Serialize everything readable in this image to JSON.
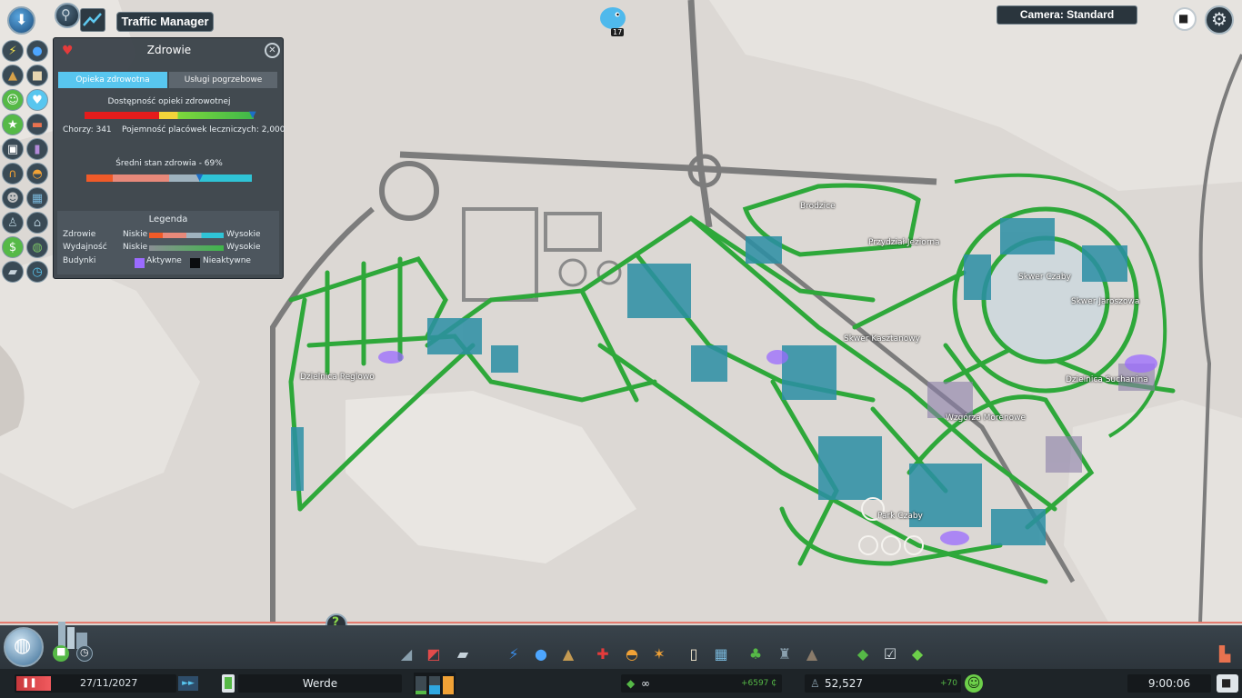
{
  "top": {
    "traffic_manager_label": "Traffic Manager",
    "camera_label": "Camera: Standard",
    "chirper_count": "17"
  },
  "panel": {
    "title": "Zdrowie",
    "tabs": [
      "Opieka zdrowotna",
      "Usługi pogrzebowe"
    ],
    "availability_label": "Dostępność opieki zdrowotnej",
    "sick_label": "Chorzy: 341",
    "capacity_label": "Pojemność placówek leczniczych: 2,000",
    "avg_health_label": "Średni stan zdrowia - 69%",
    "avg_health_value": 69,
    "legend": {
      "title": "Legenda",
      "rows": [
        {
          "name": "Zdrowie",
          "low": "Niskie",
          "high": "Wysokie"
        },
        {
          "name": "Wydajność",
          "low": "Niskie",
          "high": "Wysokie"
        }
      ],
      "buildings_label": "Budynki",
      "active_label": "Aktywne",
      "inactive_label": "Nieaktywne"
    }
  },
  "districts": [
    "Dzielnica Reglowo",
    "Skwer Czaby",
    "Skwer Jaroszowa",
    "Dzielnica Suchanina",
    "Wzgórza Morenowe",
    "Park Czaby",
    "Skwer Kasztanowy",
    "Przydział Jeziorna",
    "Brodzice"
  ],
  "bottom": {
    "date": "27/11/2027",
    "city_name": "Werde",
    "money": "∞",
    "income": "+6597 ₵",
    "population": "52,527",
    "population_change": "+70",
    "time": "9:00:06"
  },
  "colors": {
    "road_green": "#2ea83a",
    "panel_bg": "#363e46",
    "tab_active": "#58c6ef",
    "map_bg": "#dcd8d4"
  }
}
